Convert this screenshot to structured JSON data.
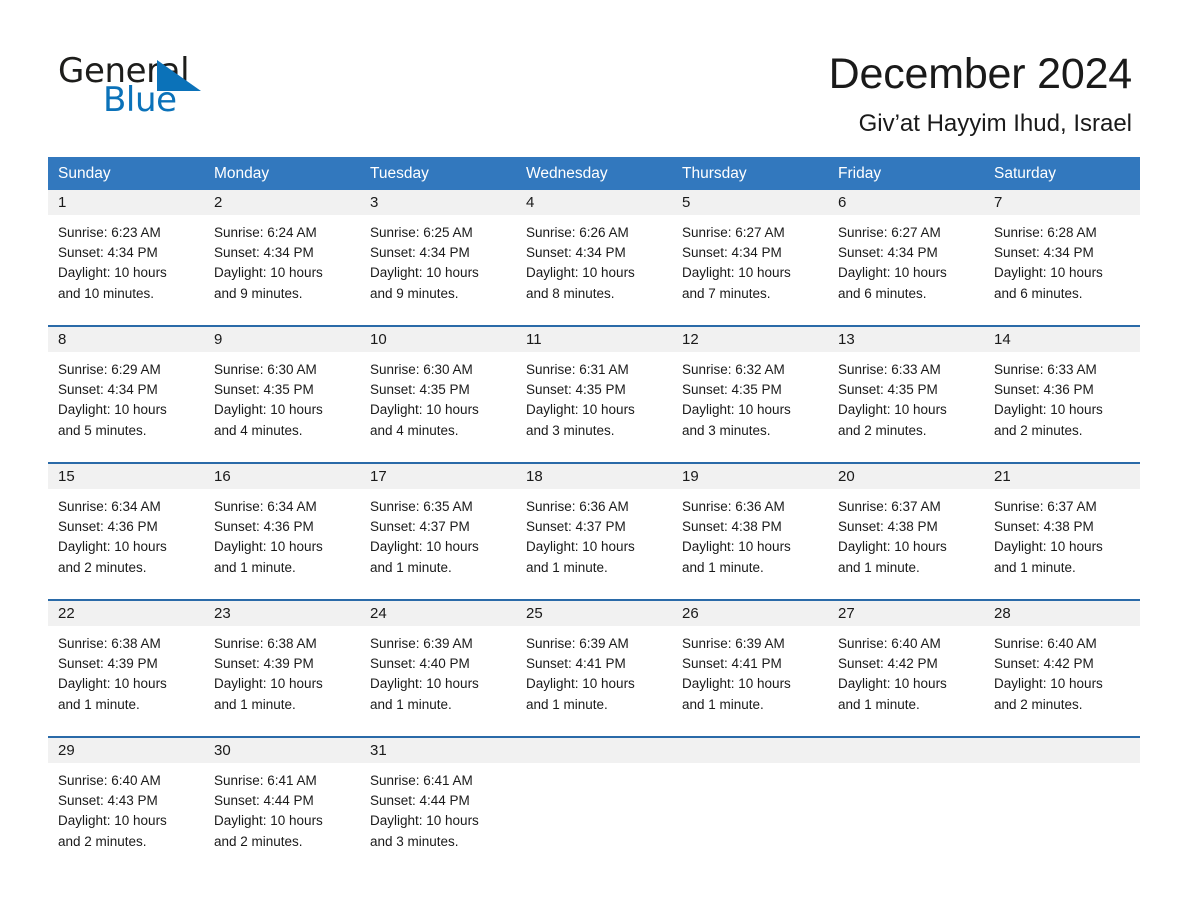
{
  "brand": {
    "name_part1": "General",
    "name_part2": "Blue",
    "triangle_color": "#0b72b9"
  },
  "header": {
    "title": "December 2024",
    "subtitle": "Giv’at Hayyim Ihud, Israel"
  },
  "colors": {
    "header_blue": "#3278be",
    "rule_blue": "#2a6aa8",
    "daynum_band": "#f1f1f1",
    "text": "#1a1a1a",
    "logo_blue": "#0b72b9"
  },
  "weekdays": [
    "Sunday",
    "Monday",
    "Tuesday",
    "Wednesday",
    "Thursday",
    "Friday",
    "Saturday"
  ],
  "weeks": [
    {
      "days": [
        {
          "num": "1",
          "l1": "Sunrise: 6:23 AM",
          "l2": "Sunset: 4:34 PM",
          "l3": "Daylight: 10 hours",
          "l4": "and 10 minutes."
        },
        {
          "num": "2",
          "l1": "Sunrise: 6:24 AM",
          "l2": "Sunset: 4:34 PM",
          "l3": "Daylight: 10 hours",
          "l4": "and 9 minutes."
        },
        {
          "num": "3",
          "l1": "Sunrise: 6:25 AM",
          "l2": "Sunset: 4:34 PM",
          "l3": "Daylight: 10 hours",
          "l4": "and 9 minutes."
        },
        {
          "num": "4",
          "l1": "Sunrise: 6:26 AM",
          "l2": "Sunset: 4:34 PM",
          "l3": "Daylight: 10 hours",
          "l4": "and 8 minutes."
        },
        {
          "num": "5",
          "l1": "Sunrise: 6:27 AM",
          "l2": "Sunset: 4:34 PM",
          "l3": "Daylight: 10 hours",
          "l4": "and 7 minutes."
        },
        {
          "num": "6",
          "l1": "Sunrise: 6:27 AM",
          "l2": "Sunset: 4:34 PM",
          "l3": "Daylight: 10 hours",
          "l4": "and 6 minutes."
        },
        {
          "num": "7",
          "l1": "Sunrise: 6:28 AM",
          "l2": "Sunset: 4:34 PM",
          "l3": "Daylight: 10 hours",
          "l4": "and 6 minutes."
        }
      ]
    },
    {
      "days": [
        {
          "num": "8",
          "l1": "Sunrise: 6:29 AM",
          "l2": "Sunset: 4:34 PM",
          "l3": "Daylight: 10 hours",
          "l4": "and 5 minutes."
        },
        {
          "num": "9",
          "l1": "Sunrise: 6:30 AM",
          "l2": "Sunset: 4:35 PM",
          "l3": "Daylight: 10 hours",
          "l4": "and 4 minutes."
        },
        {
          "num": "10",
          "l1": "Sunrise: 6:30 AM",
          "l2": "Sunset: 4:35 PM",
          "l3": "Daylight: 10 hours",
          "l4": "and 4 minutes."
        },
        {
          "num": "11",
          "l1": "Sunrise: 6:31 AM",
          "l2": "Sunset: 4:35 PM",
          "l3": "Daylight: 10 hours",
          "l4": "and 3 minutes."
        },
        {
          "num": "12",
          "l1": "Sunrise: 6:32 AM",
          "l2": "Sunset: 4:35 PM",
          "l3": "Daylight: 10 hours",
          "l4": "and 3 minutes."
        },
        {
          "num": "13",
          "l1": "Sunrise: 6:33 AM",
          "l2": "Sunset: 4:35 PM",
          "l3": "Daylight: 10 hours",
          "l4": "and 2 minutes."
        },
        {
          "num": "14",
          "l1": "Sunrise: 6:33 AM",
          "l2": "Sunset: 4:36 PM",
          "l3": "Daylight: 10 hours",
          "l4": "and 2 minutes."
        }
      ]
    },
    {
      "days": [
        {
          "num": "15",
          "l1": "Sunrise: 6:34 AM",
          "l2": "Sunset: 4:36 PM",
          "l3": "Daylight: 10 hours",
          "l4": "and 2 minutes."
        },
        {
          "num": "16",
          "l1": "Sunrise: 6:34 AM",
          "l2": "Sunset: 4:36 PM",
          "l3": "Daylight: 10 hours",
          "l4": "and 1 minute."
        },
        {
          "num": "17",
          "l1": "Sunrise: 6:35 AM",
          "l2": "Sunset: 4:37 PM",
          "l3": "Daylight: 10 hours",
          "l4": "and 1 minute."
        },
        {
          "num": "18",
          "l1": "Sunrise: 6:36 AM",
          "l2": "Sunset: 4:37 PM",
          "l3": "Daylight: 10 hours",
          "l4": "and 1 minute."
        },
        {
          "num": "19",
          "l1": "Sunrise: 6:36 AM",
          "l2": "Sunset: 4:38 PM",
          "l3": "Daylight: 10 hours",
          "l4": "and 1 minute."
        },
        {
          "num": "20",
          "l1": "Sunrise: 6:37 AM",
          "l2": "Sunset: 4:38 PM",
          "l3": "Daylight: 10 hours",
          "l4": "and 1 minute."
        },
        {
          "num": "21",
          "l1": "Sunrise: 6:37 AM",
          "l2": "Sunset: 4:38 PM",
          "l3": "Daylight: 10 hours",
          "l4": "and 1 minute."
        }
      ]
    },
    {
      "days": [
        {
          "num": "22",
          "l1": "Sunrise: 6:38 AM",
          "l2": "Sunset: 4:39 PM",
          "l3": "Daylight: 10 hours",
          "l4": "and 1 minute."
        },
        {
          "num": "23",
          "l1": "Sunrise: 6:38 AM",
          "l2": "Sunset: 4:39 PM",
          "l3": "Daylight: 10 hours",
          "l4": "and 1 minute."
        },
        {
          "num": "24",
          "l1": "Sunrise: 6:39 AM",
          "l2": "Sunset: 4:40 PM",
          "l3": "Daylight: 10 hours",
          "l4": "and 1 minute."
        },
        {
          "num": "25",
          "l1": "Sunrise: 6:39 AM",
          "l2": "Sunset: 4:41 PM",
          "l3": "Daylight: 10 hours",
          "l4": "and 1 minute."
        },
        {
          "num": "26",
          "l1": "Sunrise: 6:39 AM",
          "l2": "Sunset: 4:41 PM",
          "l3": "Daylight: 10 hours",
          "l4": "and 1 minute."
        },
        {
          "num": "27",
          "l1": "Sunrise: 6:40 AM",
          "l2": "Sunset: 4:42 PM",
          "l3": "Daylight: 10 hours",
          "l4": "and 1 minute."
        },
        {
          "num": "28",
          "l1": "Sunrise: 6:40 AM",
          "l2": "Sunset: 4:42 PM",
          "l3": "Daylight: 10 hours",
          "l4": "and 2 minutes."
        }
      ]
    },
    {
      "days": [
        {
          "num": "29",
          "l1": "Sunrise: 6:40 AM",
          "l2": "Sunset: 4:43 PM",
          "l3": "Daylight: 10 hours",
          "l4": "and 2 minutes."
        },
        {
          "num": "30",
          "l1": "Sunrise: 6:41 AM",
          "l2": "Sunset: 4:44 PM",
          "l3": "Daylight: 10 hours",
          "l4": "and 2 minutes."
        },
        {
          "num": "31",
          "l1": "Sunrise: 6:41 AM",
          "l2": "Sunset: 4:44 PM",
          "l3": "Daylight: 10 hours",
          "l4": "and 3 minutes."
        },
        {
          "num": "",
          "l1": "",
          "l2": "",
          "l3": "",
          "l4": ""
        },
        {
          "num": "",
          "l1": "",
          "l2": "",
          "l3": "",
          "l4": ""
        },
        {
          "num": "",
          "l1": "",
          "l2": "",
          "l3": "",
          "l4": ""
        },
        {
          "num": "",
          "l1": "",
          "l2": "",
          "l3": "",
          "l4": ""
        }
      ]
    }
  ]
}
